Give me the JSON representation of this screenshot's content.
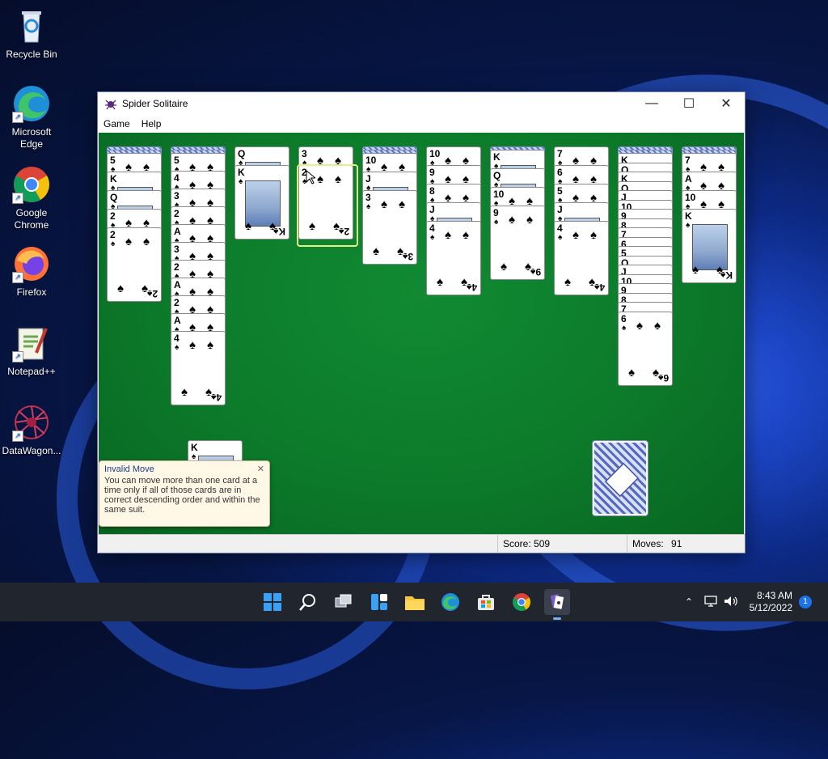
{
  "desktop": {
    "icons": [
      {
        "label": "Recycle Bin",
        "icon": "recycle-bin-icon"
      },
      {
        "label": "Microsoft\nEdge",
        "icon": "edge-icon"
      },
      {
        "label": "Google\nChrome",
        "icon": "chrome-icon"
      },
      {
        "label": "Firefox",
        "icon": "firefox-icon"
      },
      {
        "label": "Notepad++",
        "icon": "notepadpp-icon"
      },
      {
        "label": "DataWagon...",
        "icon": "datawagon-icon"
      }
    ]
  },
  "window": {
    "title": "Spider Solitaire",
    "menu": [
      "Game",
      "Help"
    ],
    "score_label": "Score: 509",
    "moves_label": "Moves:",
    "moves_value": "91"
  },
  "tableau": [
    {
      "backs": 2,
      "cards": [
        "5",
        "K",
        "Q",
        "2",
        "2"
      ]
    },
    {
      "backs": 2,
      "cards": [
        "5",
        "4",
        "3",
        "2",
        "A",
        "3",
        "2",
        "A",
        "2",
        "A",
        "4"
      ]
    },
    {
      "backs": 0,
      "cards": [
        "Q",
        "K"
      ]
    },
    {
      "backs": 0,
      "cards": [
        "3",
        "2"
      ]
    },
    {
      "backs": 2,
      "cards": [
        "10",
        "J",
        "3"
      ]
    },
    {
      "backs": 0,
      "cards": [
        "10",
        "9",
        "8",
        "J",
        "4"
      ]
    },
    {
      "backs": 1,
      "cards": [
        "K",
        "Q",
        "10",
        "9"
      ]
    },
    {
      "backs": 0,
      "cards": [
        "7",
        "6",
        "5",
        "J",
        "4"
      ]
    },
    {
      "backs": 2,
      "cards": [
        "K",
        "Q",
        "K",
        "Q",
        "J",
        "10",
        "9",
        "8",
        "7",
        "6",
        "5",
        "Q",
        "J",
        "10",
        "9",
        "8",
        "7",
        "6"
      ]
    },
    {
      "backs": 2,
      "cards": [
        "7",
        "A",
        "10",
        "K"
      ]
    }
  ],
  "dragged_card": "K",
  "tooltip": {
    "title": "Invalid Move",
    "body": "You can move more than one card at a time only if all of those cards are in correct descending order and within the same suit."
  },
  "taskbar": {
    "apps": [
      "start-icon",
      "search-icon",
      "task-view-icon",
      "widgets-icon",
      "file-explorer-icon",
      "edge-icon",
      "store-icon",
      "chrome-icon",
      "spider-solitaire-icon"
    ],
    "time": "8:43 AM",
    "date": "5/12/2022",
    "notifications": "1"
  },
  "colors": {
    "felt": "#0c7a2a",
    "taskbar": "#20252e",
    "accent": "#1a73e8"
  }
}
